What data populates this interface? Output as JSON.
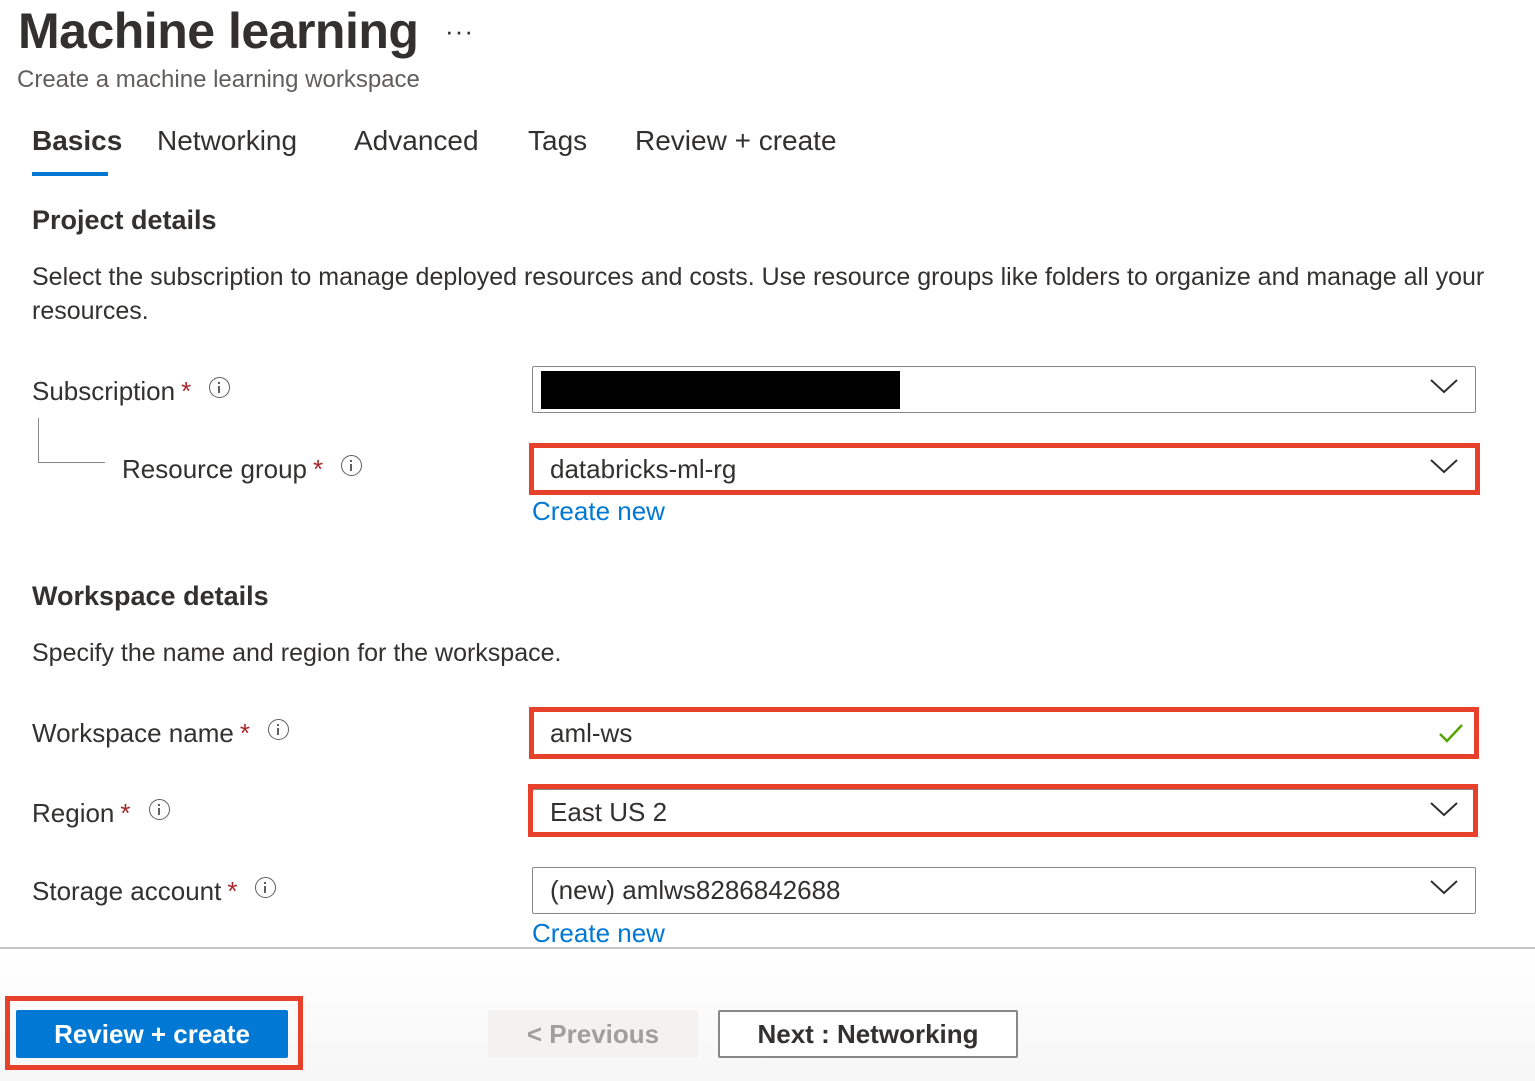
{
  "header": {
    "title": "Machine learning",
    "more_label": "···",
    "subtitle": "Create a machine learning workspace"
  },
  "tabs": [
    {
      "label": "Basics",
      "active": true
    },
    {
      "label": "Networking",
      "active": false
    },
    {
      "label": "Advanced",
      "active": false
    },
    {
      "label": "Tags",
      "active": false
    },
    {
      "label": "Review + create",
      "active": false
    }
  ],
  "project": {
    "heading": "Project details",
    "description": "Select the subscription to manage deployed resources and costs. Use resource groups like folders to organize and manage all your resources.",
    "subscription": {
      "label": "Subscription",
      "required": "*",
      "value_redacted": true
    },
    "resource_group": {
      "label": "Resource group",
      "required": "*",
      "value": "databricks-ml-rg",
      "create_new": "Create new"
    }
  },
  "workspace": {
    "heading": "Workspace details",
    "description": "Specify the name and region for the workspace.",
    "name": {
      "label": "Workspace name",
      "required": "*",
      "value": "aml-ws",
      "valid": true
    },
    "region": {
      "label": "Region",
      "required": "*",
      "value": "East US 2"
    },
    "storage": {
      "label": "Storage account",
      "required": "*",
      "value": "(new) amlws8286842688",
      "create_new": "Create new"
    }
  },
  "footer": {
    "review_create": "Review + create",
    "previous": "< Previous",
    "next": "Next : Networking"
  },
  "colors": {
    "accent": "#0078d4",
    "highlight": "#e8412b",
    "required": "#a4262c",
    "valid_check": "#57a300"
  },
  "icons": [
    "more-icon",
    "info-icon",
    "chevron-down-icon",
    "checkmark-icon"
  ]
}
